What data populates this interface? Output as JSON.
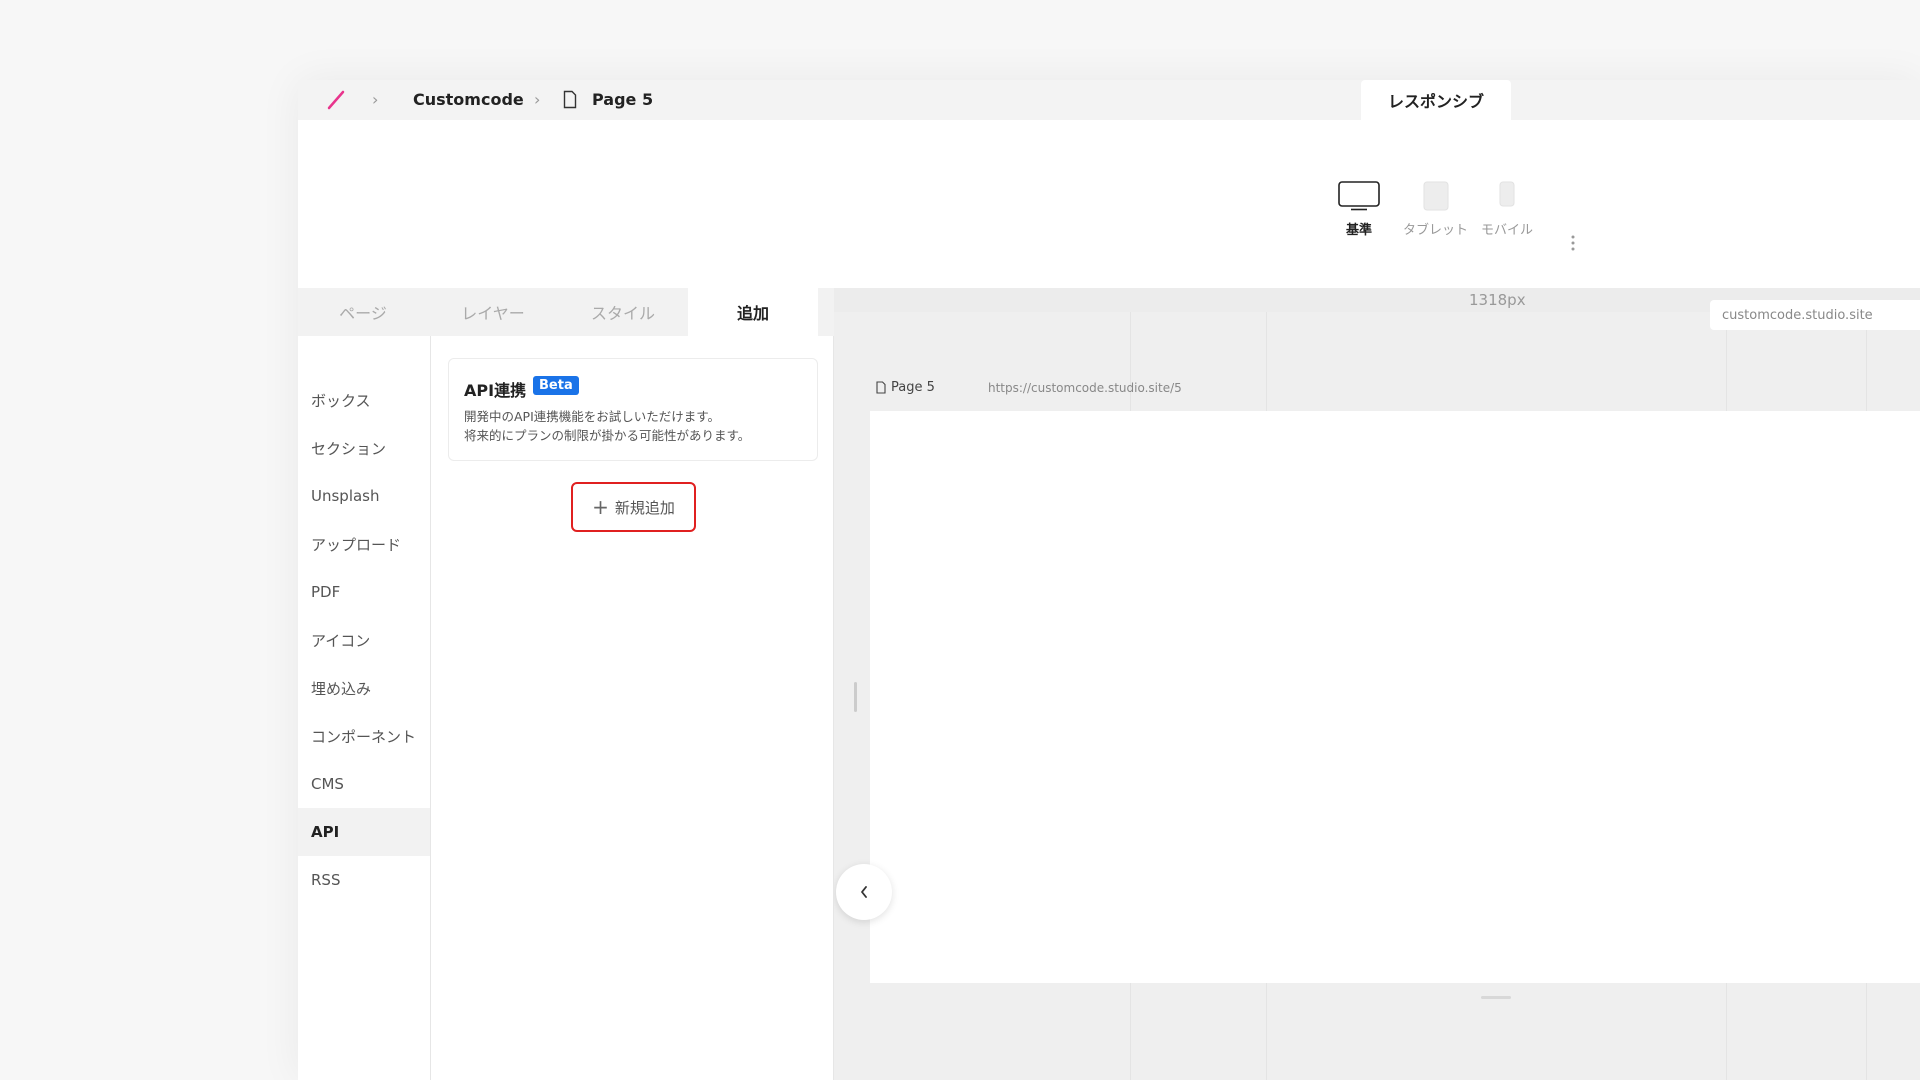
{
  "breadcrumb": {
    "project": "Customcode",
    "page": "Page 5"
  },
  "header": {
    "responsive_tab": "レスポンシブ"
  },
  "devices": [
    {
      "label": "基準",
      "active": true
    },
    {
      "label": "タブレット",
      "active": false
    },
    {
      "label": "モバイル",
      "active": false
    }
  ],
  "left_tabs": [
    {
      "label": "ページ",
      "active": false
    },
    {
      "label": "レイヤー",
      "active": false
    },
    {
      "label": "スタイル",
      "active": false
    },
    {
      "label": "追加",
      "active": true
    }
  ],
  "categories": [
    {
      "label": "ボックス",
      "active": false
    },
    {
      "label": "セクション",
      "active": false
    },
    {
      "label": "Unsplash",
      "active": false
    },
    {
      "label": "アップロード",
      "active": false
    },
    {
      "label": "PDF",
      "active": false
    },
    {
      "label": "アイコン",
      "active": false
    },
    {
      "label": "埋め込み",
      "active": false
    },
    {
      "label": "コンポーネント",
      "active": false
    },
    {
      "label": "CMS",
      "active": false
    },
    {
      "label": "API",
      "active": true
    },
    {
      "label": "RSS",
      "active": false
    }
  ],
  "api_card": {
    "title": "API連携",
    "badge": "Beta",
    "desc_line1": "開発中のAPI連携機能をお試しいただけます。",
    "desc_line2": "将来的にプランの制限が掛かる可能性があります。"
  },
  "new_button": {
    "label": "新規追加"
  },
  "canvas": {
    "width_label": "1318px",
    "site_domain": "customcode.studio.site",
    "frame_page": "Page 5",
    "frame_url": "https://customcode.studio.site/5"
  },
  "colors": {
    "accent": "#1a73e8",
    "highlight": "#e02020",
    "logo": "#e8348c"
  }
}
